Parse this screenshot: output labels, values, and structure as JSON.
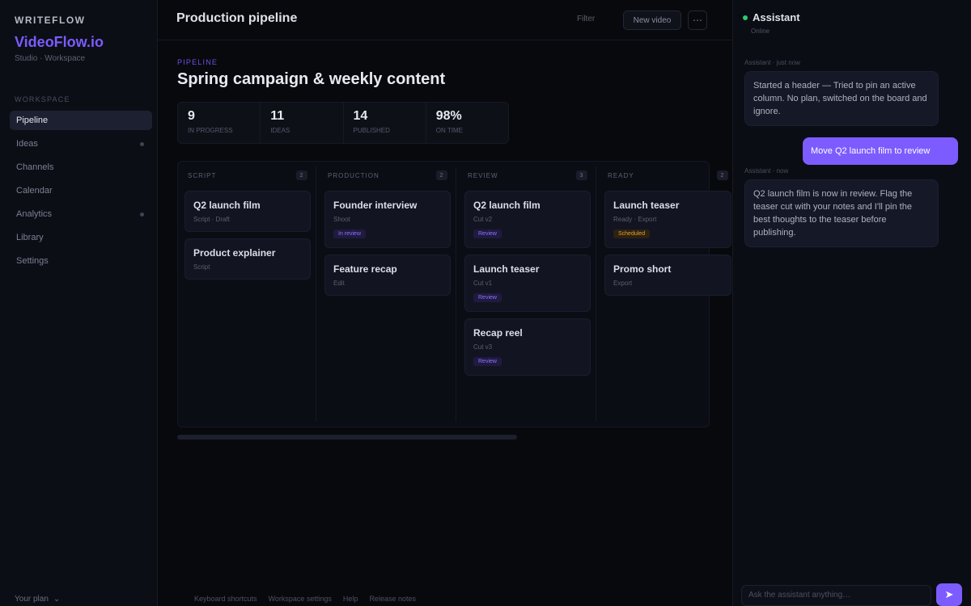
{
  "sidebar": {
    "eyebrow": "WRITEFLOW",
    "brand": "VideoFlow.io",
    "meta": "Studio · Workspace",
    "section": "WORKSPACE",
    "items": [
      {
        "label": "Pipeline",
        "active": true
      },
      {
        "label": "Ideas",
        "active": false
      },
      {
        "label": "Channels",
        "active": false
      },
      {
        "label": "Calendar",
        "active": false
      },
      {
        "label": "Analytics",
        "active": false
      },
      {
        "label": "Library",
        "active": false
      },
      {
        "label": "Settings",
        "active": false
      }
    ],
    "footer": "Your plan"
  },
  "topbar": {
    "title": "Production pipeline",
    "link": "Filter",
    "button": "New video",
    "icon": "more-icon"
  },
  "main": {
    "eyebrow": "PIPELINE",
    "title": "Spring campaign & weekly content",
    "stats": [
      {
        "value": "9",
        "label": "IN PROGRESS"
      },
      {
        "value": "11",
        "label": "IDEAS"
      },
      {
        "value": "14",
        "label": "PUBLISHED"
      },
      {
        "value": "98%",
        "label": "ON TIME"
      }
    ]
  },
  "board": {
    "columns": [
      {
        "title": "SCRIPT",
        "count": "2",
        "cards": [
          {
            "title": "Q2 launch film",
            "meta": "Script · Draft",
            "tag": "",
            "tag_color": ""
          },
          {
            "title": "Product explainer",
            "meta": "Script",
            "tag": "",
            "tag_color": ""
          }
        ]
      },
      {
        "title": "PRODUCTION",
        "count": "2",
        "cards": [
          {
            "title": "Founder interview",
            "meta": "Shoot",
            "tag": "In review",
            "tag_color": "purple"
          },
          {
            "title": "Feature recap",
            "meta": "Edit",
            "tag": "",
            "tag_color": ""
          }
        ]
      },
      {
        "title": "REVIEW",
        "count": "3",
        "cards": [
          {
            "title": "Q2 launch film",
            "meta": "Cut v2",
            "tag": "Review",
            "tag_color": "purple"
          },
          {
            "title": "Launch teaser",
            "meta": "Cut v1",
            "tag": "Review",
            "tag_color": "purple"
          },
          {
            "title": "Recap reel",
            "meta": "Cut v3",
            "tag": "Review",
            "tag_color": "purple"
          }
        ]
      },
      {
        "title": "READY",
        "count": "2",
        "cards": [
          {
            "title": "Launch teaser",
            "meta": "Ready · Export",
            "tag": "Scheduled",
            "tag_color": "amber"
          },
          {
            "title": "Promo short",
            "meta": "Export",
            "tag": "",
            "tag_color": ""
          }
        ]
      }
    ]
  },
  "footer_links": [
    "Keyboard shortcuts",
    "Workspace settings",
    "Help",
    "Release notes"
  ],
  "assistant": {
    "title": "Assistant",
    "subtitle": "Online",
    "messages": [
      {
        "role": "bot",
        "meta": "Assistant · just now",
        "text": "Started a header — Tried to pin an active column. No plan, switched on the board and ignore."
      },
      {
        "role": "user",
        "meta": "",
        "text": "Move Q2 launch film to review"
      },
      {
        "role": "bot",
        "meta": "Assistant · now",
        "text": "Q2 launch film is now in review. Flag the teaser cut with your notes and I'll pin the best thoughts to the teaser before publishing."
      }
    ],
    "composer_placeholder": "Ask the assistant anything…",
    "send_icon": "send-icon"
  }
}
